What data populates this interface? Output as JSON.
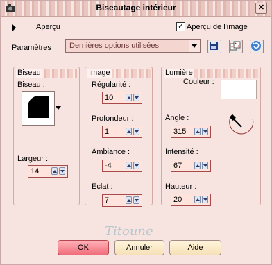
{
  "window": {
    "title": "Biseautage intérieur",
    "close_glyph": "✕"
  },
  "preview": {
    "label": "Aperçu",
    "checkbox_label": "Aperçu de l'image",
    "checked": true
  },
  "presets": {
    "label": "Paramètres",
    "value": "Dernières options utilisées"
  },
  "bevel_panel": {
    "header": "Biseau",
    "bevel_label": "Biseau :",
    "width_label": "Largeur :",
    "width_value": "14"
  },
  "image_panel": {
    "header": "Image",
    "fields": [
      {
        "label": "Régularité :",
        "value": "10"
      },
      {
        "label": "Profondeur :",
        "value": "1"
      },
      {
        "label": "Ambiance :",
        "value": "-4"
      },
      {
        "label": "Éclat :",
        "value": "7"
      }
    ]
  },
  "light_panel": {
    "header": "Lumière",
    "color_label": "Couleur :",
    "color": "#ffffff",
    "fields": [
      {
        "label": "Angle :",
        "value": "315"
      },
      {
        "label": "Intensité :",
        "value": "67"
      },
      {
        "label": "Hauteur :",
        "value": "20"
      }
    ]
  },
  "watermark": "Titoune",
  "buttons": {
    "ok": "OK",
    "cancel": "Annuler",
    "help": "Aide"
  },
  "colors": {
    "background": "#f7e3df",
    "ok_button": "#ef6d7a",
    "field_border": "#a94a4a"
  }
}
